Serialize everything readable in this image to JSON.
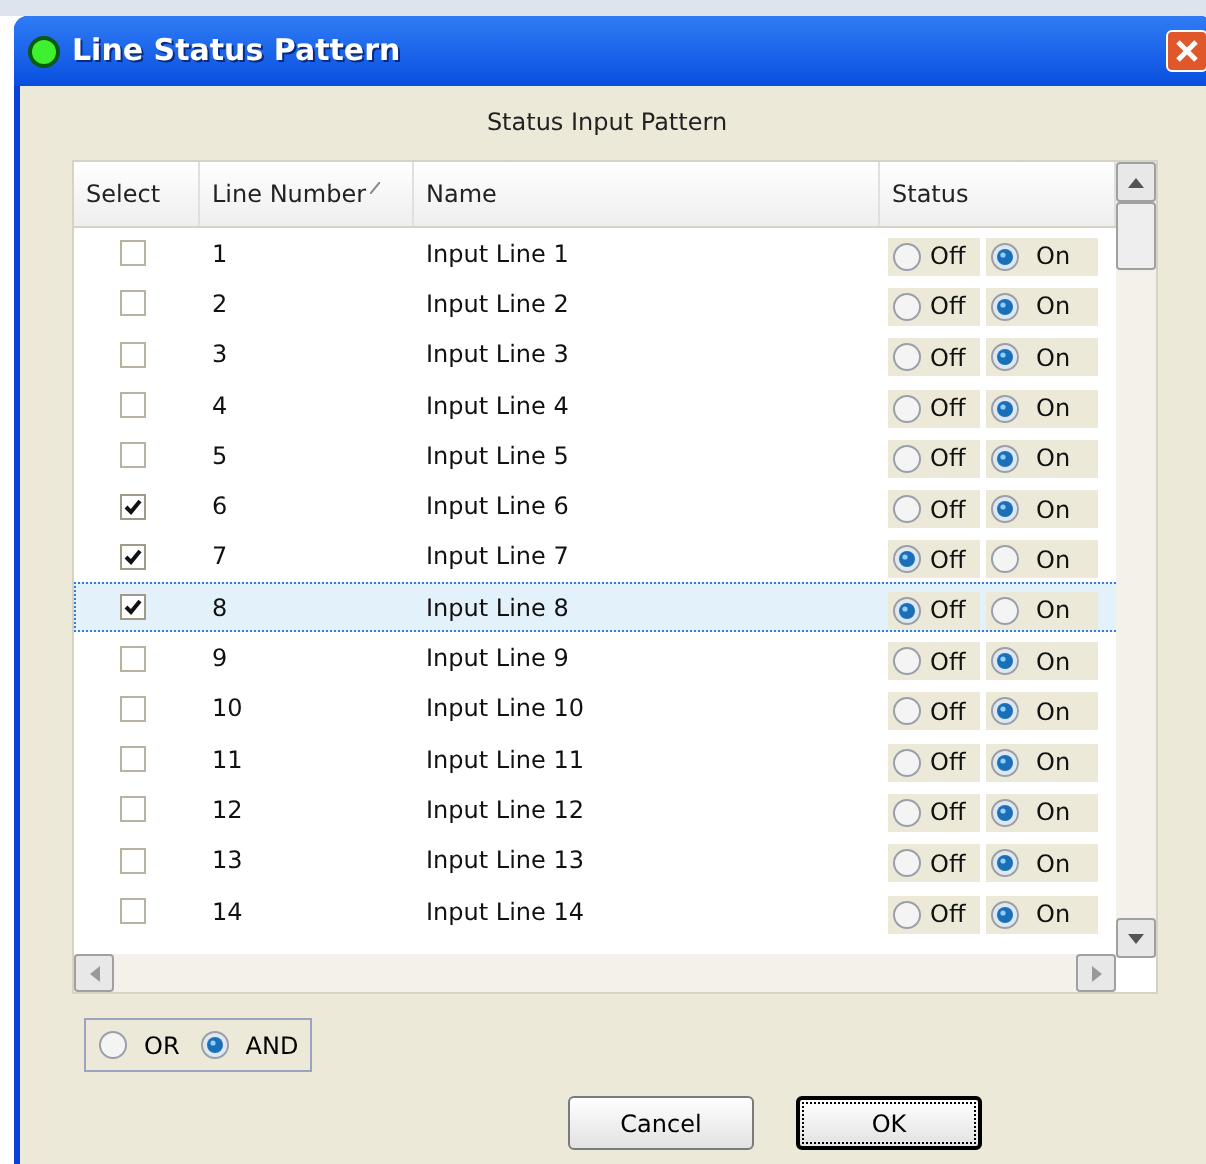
{
  "window": {
    "title": "Line Status Pattern"
  },
  "heading": "Status Input Pattern",
  "table": {
    "columns": [
      "Select",
      "Line Number",
      "Name",
      "Status"
    ],
    "rows": [
      {
        "checked": false,
        "number": "1",
        "name": "Input Line 1",
        "selected": false,
        "options": [
          {
            "label": "Off",
            "selected": false
          },
          {
            "label": "On",
            "selected": true
          }
        ]
      },
      {
        "checked": false,
        "number": "2",
        "name": "Input Line 2",
        "selected": false,
        "options": [
          {
            "label": "Off",
            "selected": false
          },
          {
            "label": "On",
            "selected": true
          }
        ]
      },
      {
        "checked": false,
        "number": "3",
        "name": "Input Line 3",
        "selected": false,
        "options": [
          {
            "label": "Off",
            "selected": false
          },
          {
            "label": "On",
            "selected": true
          }
        ]
      },
      {
        "checked": false,
        "number": "4",
        "name": "Input Line 4",
        "selected": false,
        "options": [
          {
            "label": "Off",
            "selected": false
          },
          {
            "label": "On",
            "selected": true
          }
        ]
      },
      {
        "checked": false,
        "number": "5",
        "name": "Input Line 5",
        "selected": false,
        "options": [
          {
            "label": "Off",
            "selected": false
          },
          {
            "label": "On",
            "selected": true
          }
        ]
      },
      {
        "checked": true,
        "number": "6",
        "name": "Input Line 6",
        "selected": false,
        "options": [
          {
            "label": "Off",
            "selected": false
          },
          {
            "label": "On",
            "selected": true
          }
        ]
      },
      {
        "checked": true,
        "number": "7",
        "name": "Input Line 7",
        "selected": false,
        "options": [
          {
            "label": "Off",
            "selected": true
          },
          {
            "label": "On",
            "selected": false
          }
        ]
      },
      {
        "checked": true,
        "number": "8",
        "name": "Input Line 8",
        "selected": true,
        "options": [
          {
            "label": "Off",
            "selected": true
          },
          {
            "label": "On",
            "selected": false
          }
        ]
      },
      {
        "checked": false,
        "number": "9",
        "name": "Input Line 9",
        "selected": false,
        "options": [
          {
            "label": "Off",
            "selected": false
          },
          {
            "label": "On",
            "selected": true
          }
        ]
      },
      {
        "checked": false,
        "number": "10",
        "name": "Input Line 10",
        "selected": false,
        "options": [
          {
            "label": "Off",
            "selected": false
          },
          {
            "label": "On",
            "selected": true
          }
        ]
      },
      {
        "checked": false,
        "number": "11",
        "name": "Input Line 11",
        "selected": false,
        "options": [
          {
            "label": "Off",
            "selected": false
          },
          {
            "label": "On",
            "selected": true
          }
        ]
      },
      {
        "checked": false,
        "number": "12",
        "name": "Input Line 12",
        "selected": false,
        "options": [
          {
            "label": "Off",
            "selected": false
          },
          {
            "label": "On",
            "selected": true
          }
        ]
      },
      {
        "checked": false,
        "number": "13",
        "name": "Input Line 13",
        "selected": false,
        "options": [
          {
            "label": "Off",
            "selected": false
          },
          {
            "label": "On",
            "selected": true
          }
        ]
      },
      {
        "checked": false,
        "number": "14",
        "name": "Input Line 14",
        "selected": false,
        "options": [
          {
            "label": "Off",
            "selected": false
          },
          {
            "label": "On",
            "selected": true
          }
        ]
      }
    ]
  },
  "logic": [
    {
      "label": "OR",
      "selected": false
    },
    {
      "label": "AND",
      "selected": true
    }
  ],
  "buttons": [
    {
      "label": "Cancel",
      "default": false
    },
    {
      "label": "OK",
      "default": true
    }
  ]
}
